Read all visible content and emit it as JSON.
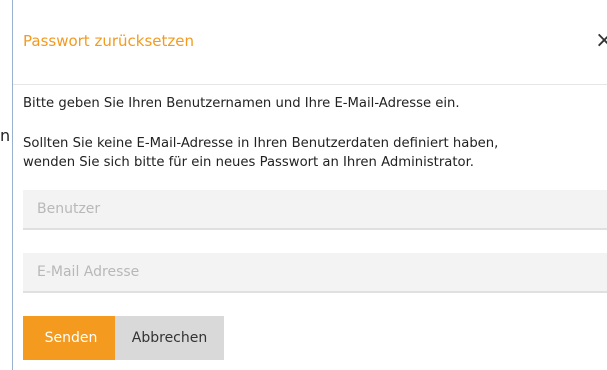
{
  "backdrop": {
    "text_fragment": "n"
  },
  "dialog": {
    "title": "Passwort zurücksetzen",
    "close_label": "×",
    "instruction": "Bitte geben Sie Ihren Benutzernamen und Ihre E-Mail-Adresse ein.",
    "note_line1": "Sollten Sie keine E-Mail-Adresse in Ihren Benutzerdaten definiert haben,",
    "note_line2": "wenden Sie sich bitte für ein neues Passwort an Ihren Administrator.",
    "username_placeholder": "Benutzer",
    "email_placeholder": "E-Mail Adresse",
    "send_label": "Senden",
    "cancel_label": "Abbrechen"
  },
  "colors": {
    "accent": "#f39a1f",
    "cancel_bg": "#d9d9d9",
    "input_bg": "#f3f3f3"
  }
}
